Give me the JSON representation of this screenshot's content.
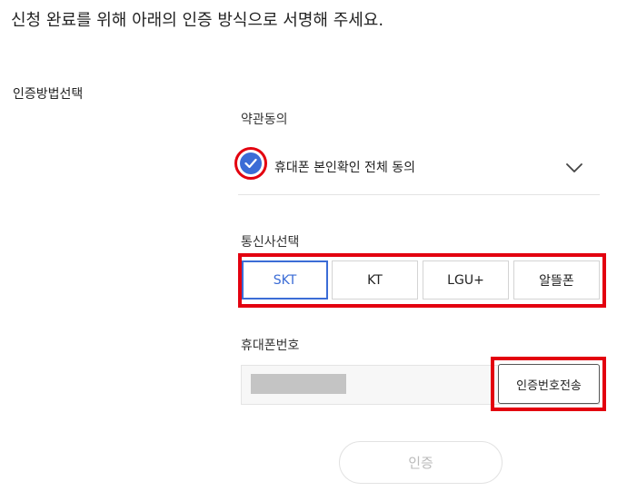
{
  "instruction": "신청 완료를 위해 아래의 인증 방식으로 서명해 주세요.",
  "section_label": "인증방법선택",
  "terms": {
    "label": "약관동의",
    "agree_all_text": "휴대폰 본인확인 전체 동의",
    "checked": true
  },
  "carrier": {
    "label": "통신사선택",
    "options": [
      "SKT",
      "KT",
      "LGU+",
      "알뜰폰"
    ],
    "selected": "SKT"
  },
  "phone": {
    "label": "휴대폰번호",
    "send_button": "인증번호전송"
  },
  "verify_button": "인증",
  "colors": {
    "accent": "#3b6cd6",
    "highlight": "#e3000f",
    "disabled_text": "#bbbbbb"
  }
}
